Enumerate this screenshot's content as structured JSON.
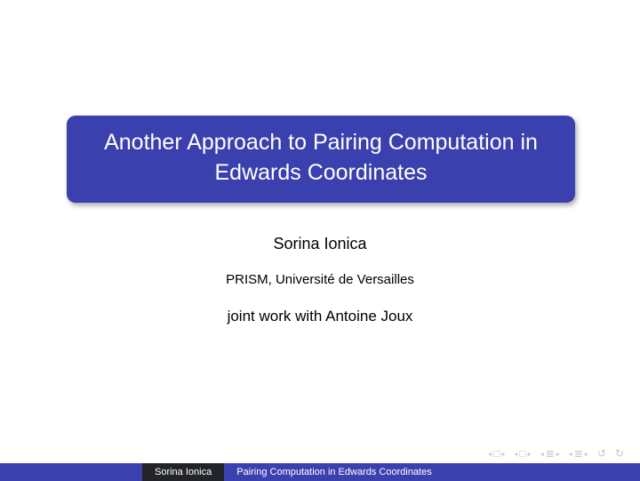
{
  "title": {
    "line1": "Another Approach to Pairing Computation in",
    "line2": "Edwards Coordinates"
  },
  "author": "Sorina Ionica",
  "affiliation": "PRISM, Université de Versailles",
  "joint_work": "joint work with Antoine Joux",
  "nav": {
    "first_prev": "◂",
    "first_mid": "□",
    "first_next": "▸",
    "second_prev": "◂",
    "second_mid": "□",
    "second_next": "▸",
    "third_prev": "◂",
    "third_mid": "≣",
    "third_next": "▸",
    "fourth_prev": "◂",
    "fourth_mid": "≣",
    "fourth_next": "▸",
    "back": "↺",
    "forward": "↻"
  },
  "footer": {
    "author": "Sorina Ionica",
    "title": "Pairing Computation in Edwards Coordinates"
  }
}
